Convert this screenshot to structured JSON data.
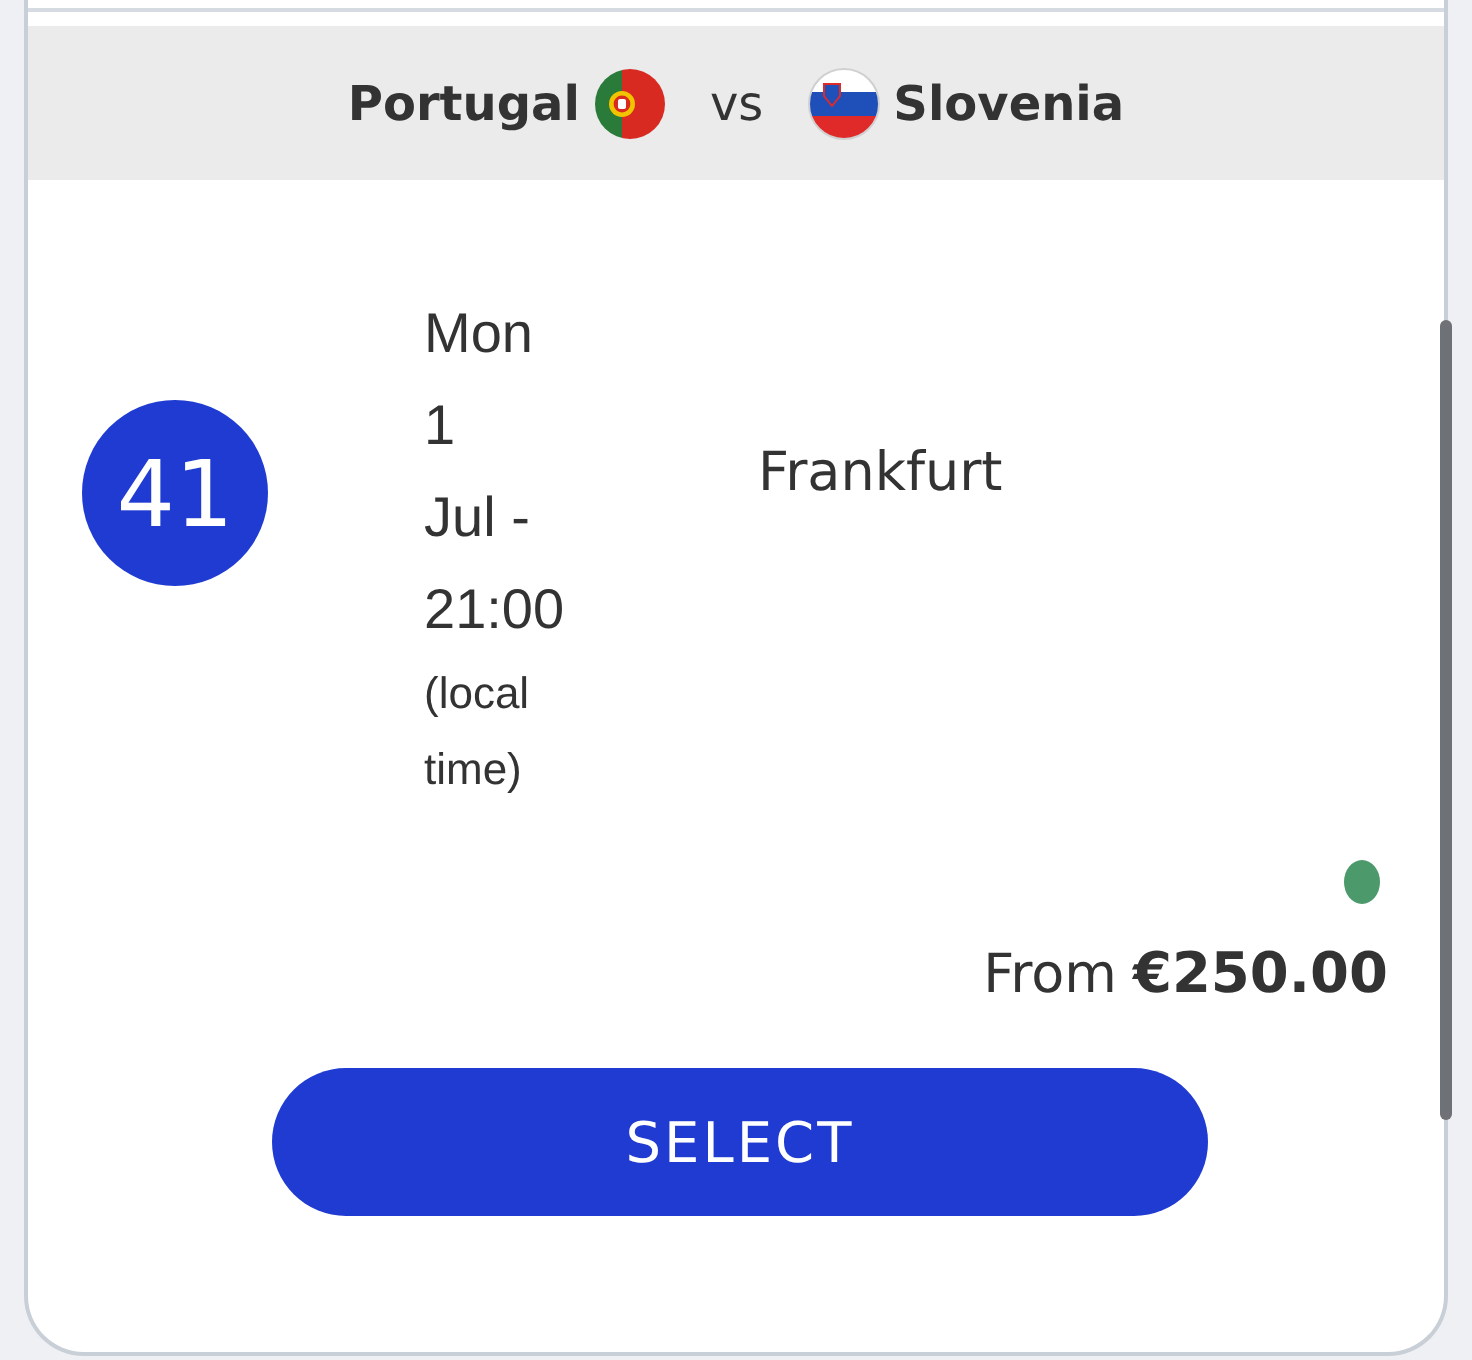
{
  "match": {
    "teams": [
      {
        "name": "Portugal"
      },
      {
        "name": "Slovenia"
      }
    ],
    "versus": "vs"
  },
  "fixture": {
    "number": "41",
    "date_time": "Mon 1 Jul - 21:00",
    "time_note": "(local time)",
    "venue": "Frankfurt"
  },
  "availability": {
    "available": true
  },
  "price": {
    "prefix": "From",
    "amount": "€250.00"
  },
  "select_button": {
    "label": "SELECT"
  }
}
